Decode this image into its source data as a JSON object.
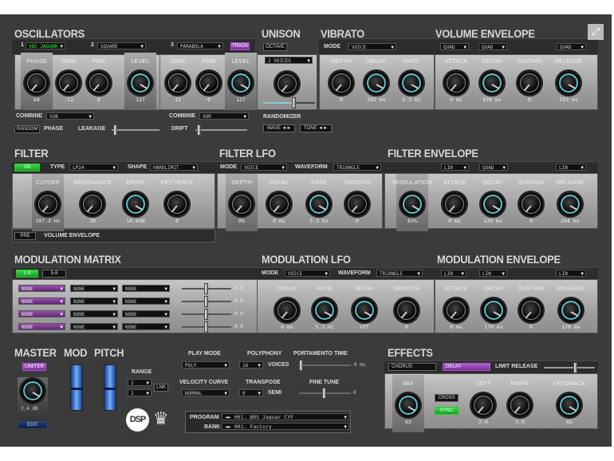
{
  "osc": {
    "title": "OSCILLATORS",
    "num1": "1",
    "wave1": "VOC JAGUAR",
    "num2": "2",
    "wave2": "SQUARE",
    "num3": "3",
    "wave3": "PARABOLA",
    "track": "TRACK",
    "knobs": [
      {
        "label": "PHASE",
        "value": "64"
      },
      {
        "label": "SEMI",
        "value": "-12"
      },
      {
        "label": "FINE",
        "value": "0"
      },
      {
        "label": "LEVEL",
        "value": "127"
      },
      {
        "label": "SEMI",
        "value": "12"
      },
      {
        "label": "FINE",
        "value": "0"
      },
      {
        "label": "LEVEL",
        "value": "127"
      }
    ],
    "combine_label": "COMBINE",
    "combine1": "SUB",
    "combine2": "XOR",
    "random": "RANDOM",
    "phase": "PHASE",
    "leakage": "LEAKAGE",
    "drift": "DRIFT"
  },
  "unison": {
    "title": "UNISON",
    "octave": "OCTAVE",
    "voices": "2 VOICES",
    "randomizer": "RANDOMIZER",
    "wave": "WAVE ◄►",
    "tone": "TONE ◄►"
  },
  "vibrato": {
    "title": "VIBRATO",
    "mode_label": "MODE",
    "mode": "VOICE",
    "knobs": [
      {
        "label": "DEPTH",
        "value": "0"
      },
      {
        "label": "DELAY",
        "value": "392 ms"
      },
      {
        "label": "RATE",
        "value": "5.3 Hz"
      }
    ]
  },
  "vol_env": {
    "title": "VOLUME ENVELOPE",
    "curves": [
      "QUAD",
      "QUAD",
      "QUAD"
    ],
    "knobs": [
      {
        "label": "ATTACK",
        "value": "0 ms"
      },
      {
        "label": "DECAY",
        "value": "439 ms"
      },
      {
        "label": "SUSTAIN",
        "value": "0"
      },
      {
        "label": "RELEASE",
        "value": "233 ms"
      }
    ]
  },
  "filter": {
    "title": "FILTER",
    "on": "ON",
    "type_label": "TYPE",
    "type": "LP24",
    "shape_label": "SHAPE",
    "shape": "HARDLIMIT",
    "knobs": [
      {
        "label": "CUTOFF",
        "value": "107.3 Hz"
      },
      {
        "label": "RESONANCE",
        "value": "29"
      },
      {
        "label": "DRIVE",
        "value": "14.6dB"
      },
      {
        "label": "KEYTRACK",
        "value": "0"
      }
    ],
    "pre": "PRE",
    "env_label": "VOLUME ENVELOPE"
  },
  "filter_lfo": {
    "title": "FILTER LFO",
    "mode_label": "MODE",
    "mode": "VOICE",
    "waveform_label": "WAVEFORM",
    "waveform": "TRIANGLE",
    "knobs": [
      {
        "label": "DEPTH",
        "value": "0%"
      },
      {
        "label": "DELAY",
        "value": "0 ms"
      },
      {
        "label": "RATE",
        "value": "5.3 Hz"
      },
      {
        "label": "SMOOTH",
        "value": "0"
      }
    ]
  },
  "filter_env": {
    "title": "FILTER ENVELOPE",
    "curves": [
      "LIN",
      "QUAD",
      "LIN"
    ],
    "knobs": [
      {
        "label": "MODULATION",
        "value": "63%"
      },
      {
        "label": "ATTACK",
        "value": "0 ms"
      },
      {
        "label": "DECAY",
        "value": "130 ms"
      },
      {
        "label": "SUSTAIN",
        "value": "0"
      },
      {
        "label": "RELEASE",
        "value": "204 ms"
      }
    ]
  },
  "mod_matrix": {
    "title": "MODULATION MATRIX",
    "tabs": [
      "1-4",
      "5-8"
    ],
    "rows": [
      {
        "source": "NONE",
        "dest": "NONE",
        "via": "NONE",
        "amount": "0.0"
      },
      {
        "source": "NONE",
        "dest": "NONE",
        "via": "NONE",
        "amount": "0.0"
      },
      {
        "source": "NONE",
        "dest": "NONE",
        "via": "NONE",
        "amount": "0.0"
      },
      {
        "source": "NONE",
        "dest": "NONE",
        "via": "NONE",
        "amount": "0.0"
      }
    ]
  },
  "mod_lfo": {
    "title": "MODULATION LFO",
    "mode_label": "MODE",
    "mode": "VOICE",
    "waveform_label": "WAVEFORM",
    "waveform": "TRIANGLE",
    "knobs": [
      {
        "label": "DELAY",
        "value": "0 ms"
      },
      {
        "label": "RATE",
        "value": "5.3 Hz"
      },
      {
        "label": "DECAY",
        "value": "off"
      },
      {
        "label": "SMOOTH",
        "value": "0"
      }
    ]
  },
  "mod_env": {
    "title": "MODULATION ENVELOPE",
    "curves": [
      "LIN",
      "LIN",
      "LIN"
    ],
    "knobs": [
      {
        "label": "ATTACK",
        "value": "0 ms"
      },
      {
        "label": "DECAY",
        "value": "170 ms"
      },
      {
        "label": "SUSTAIN",
        "value": "0"
      },
      {
        "label": "RELEASE",
        "value": "170 ms"
      }
    ]
  },
  "master": {
    "title": "MASTER",
    "limiter": "LIMITER",
    "value": "3.4 dB",
    "edit": "EDIT"
  },
  "mod": {
    "title": "MOD"
  },
  "pitch": {
    "title": "PITCH",
    "range_label": "RANGE",
    "range_up": "2",
    "range_down": "2",
    "link": "LNK"
  },
  "play": {
    "mode_label": "PLAY MODE",
    "mode": "POLY",
    "poly_label": "POLYPHONY",
    "poly": "16",
    "voices": "VOICES",
    "porta_label": "PORTAMENTO TIME",
    "porta_value": "0 ms",
    "vel_label": "VELOCITY CURVE",
    "vel": "NORMAL",
    "transpose_label": "TRANSPOSE",
    "transpose": "0",
    "semi": "SEMI",
    "finetune_label": "FINE TUNE",
    "finetune_value": "0"
  },
  "logo": {
    "dsp": "DSP"
  },
  "program": {
    "program_label": "PROGRAM",
    "program": "◄► 001. BRS Jaguar CYF",
    "bank_label": "BANK",
    "bank": "◄► 001. Factory"
  },
  "effects": {
    "title": "EFFECTS",
    "chorus": "CHORUS",
    "delay": "DELAY",
    "limit_release": "LIMIT RELEASE",
    "mix": {
      "label": "MIX",
      "value": "63"
    },
    "cross": "CROSS",
    "sync": "SYNC",
    "knobs": [
      {
        "label": "LEFT",
        "value": "2.0"
      },
      {
        "label": "RIGHT",
        "value": "2.0"
      },
      {
        "label": "FEEDBACK",
        "value": "62"
      }
    ]
  }
}
